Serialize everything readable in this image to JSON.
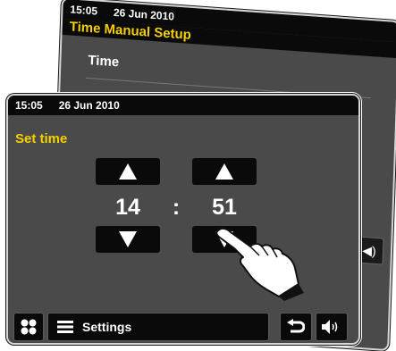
{
  "back_screen": {
    "status": {
      "time": "15:05",
      "date": "26 Jun 2010"
    },
    "title": "Time Manual Setup",
    "menu_items": [
      "Time"
    ]
  },
  "front_screen": {
    "status": {
      "time": "15:05",
      "date": "26 Jun 2010"
    },
    "title": "Set time",
    "hour": "14",
    "separator": ":",
    "minute": "51",
    "bottom_bar": {
      "settings_label": "Settings"
    }
  },
  "colors": {
    "accent": "#f4d000",
    "screen_bg": "#4a4a4a",
    "bar_bg": "#0a0a0a"
  },
  "icons": [
    "up-arrow-icon",
    "down-arrow-icon",
    "grid-icon",
    "menu-icon",
    "back-icon",
    "volume-icon",
    "hand-pointer-icon"
  ]
}
